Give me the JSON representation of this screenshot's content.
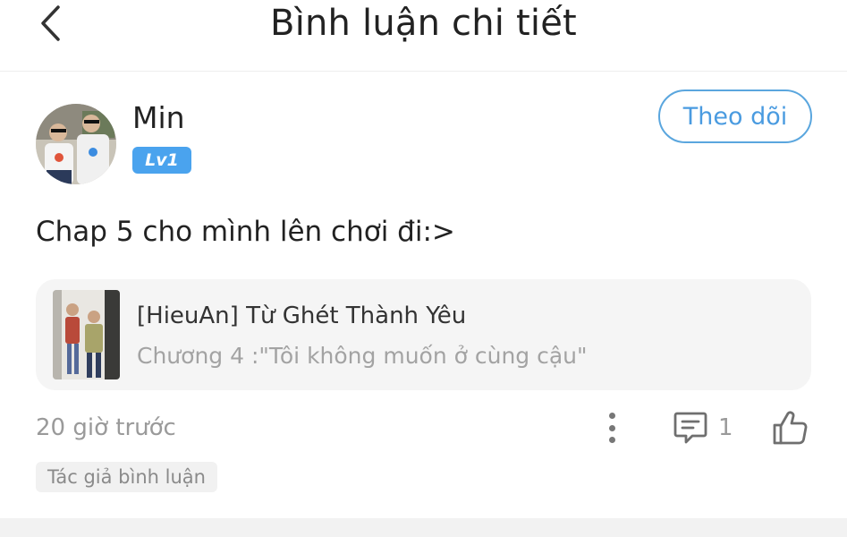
{
  "header": {
    "title": "Bình luận chi tiết",
    "back_icon": "chevron-left-icon"
  },
  "comment": {
    "username": "Min",
    "level": "Lv1",
    "follow_label": "Theo dõi",
    "text": "Chap 5 cho mình lên chơi đi:>",
    "story": {
      "title": "[HieuAn] Từ Ghét Thành Yêu",
      "chapter": "Chương 4 :\"Tôi không muốn ở cùng cậu\""
    },
    "time": "20 giờ trước",
    "reply_count": "1",
    "author_tag": "Tác giả bình luận"
  },
  "colors": {
    "accent": "#4a9be0",
    "level_badge": "#4aa3ee",
    "muted_text": "#9a9a9a",
    "card_bg": "#f5f5f5"
  }
}
